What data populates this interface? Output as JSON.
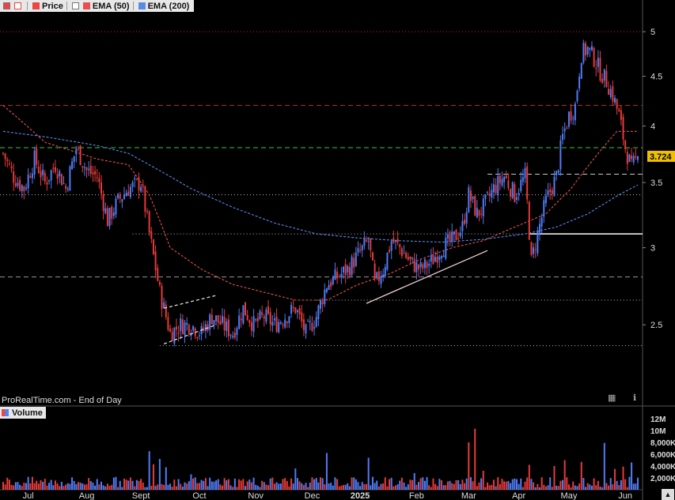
{
  "legend": {
    "price_label": "Price",
    "ema50_label": "EMA (50)",
    "ema200_label": "EMA (200)"
  },
  "source_text": "ProRealTime.com - End of Day",
  "volume_label": "Volume",
  "last_price": "3.724",
  "colors": {
    "up": "#4f7df7",
    "down": "#e83a3a",
    "ema50": "#e85050",
    "ema200": "#5a8ae6",
    "background": "#000000",
    "last_price_badge": "#f0c000"
  },
  "chart_data": [
    {
      "type": "candlestick",
      "title": "",
      "x_tick_labels": [
        "Jul",
        "Aug",
        "Sept",
        "Oct",
        "Nov",
        "Dec",
        "2025",
        "Feb",
        "Mar",
        "Apr",
        "May",
        "Jun"
      ],
      "y_tick_labels": [
        "2.5",
        "3",
        "3.5",
        "4",
        "4.5",
        "5"
      ],
      "ylim": [
        2.15,
        5.25
      ],
      "scale": "log",
      "anchors_close": [
        [
          0,
          3.75
        ],
        [
          5,
          3.55
        ],
        [
          10,
          3.45
        ],
        [
          15,
          3.7
        ],
        [
          20,
          3.5
        ],
        [
          25,
          3.65
        ],
        [
          30,
          3.45
        ],
        [
          35,
          3.8
        ],
        [
          40,
          3.6
        ],
        [
          45,
          3.55
        ],
        [
          50,
          3.2
        ],
        [
          55,
          3.35
        ],
        [
          60,
          3.45
        ],
        [
          66,
          3.5
        ],
        [
          70,
          3.1
        ],
        [
          75,
          2.7
        ],
        [
          80,
          2.45
        ],
        [
          85,
          2.5
        ],
        [
          90,
          2.5
        ],
        [
          95,
          2.45
        ],
        [
          100,
          2.55
        ],
        [
          105,
          2.5
        ],
        [
          110,
          2.45
        ],
        [
          115,
          2.6
        ],
        [
          120,
          2.5
        ],
        [
          125,
          2.55
        ],
        [
          130,
          2.5
        ],
        [
          135,
          2.55
        ],
        [
          140,
          2.6
        ],
        [
          145,
          2.45
        ],
        [
          150,
          2.55
        ],
        [
          155,
          2.75
        ],
        [
          160,
          2.8
        ],
        [
          165,
          2.85
        ],
        [
          170,
          2.95
        ],
        [
          175,
          3.05
        ],
        [
          178,
          2.75
        ],
        [
          182,
          2.85
        ],
        [
          186,
          3.05
        ],
        [
          190,
          3.0
        ],
        [
          195,
          2.9
        ],
        [
          200,
          2.85
        ],
        [
          205,
          2.9
        ],
        [
          210,
          3.0
        ],
        [
          215,
          3.05
        ],
        [
          220,
          3.15
        ],
        [
          223,
          3.4
        ],
        [
          227,
          3.25
        ],
        [
          230,
          3.3
        ],
        [
          235,
          3.45
        ],
        [
          240,
          3.55
        ],
        [
          245,
          3.4
        ],
        [
          250,
          3.55
        ],
        [
          253,
          2.9
        ],
        [
          256,
          3.1
        ],
        [
          260,
          3.35
        ],
        [
          265,
          3.55
        ],
        [
          268,
          3.9
        ],
        [
          271,
          4.1
        ],
        [
          274,
          4.2
        ],
        [
          277,
          4.75
        ],
        [
          280,
          4.8
        ],
        [
          283,
          4.7
        ],
        [
          286,
          4.55
        ],
        [
          289,
          4.45
        ],
        [
          292,
          4.3
        ],
        [
          295,
          4.1
        ],
        [
          298,
          3.8
        ],
        [
          301,
          3.62
        ],
        [
          304,
          3.724
        ]
      ],
      "ema50": [
        [
          0,
          4.2
        ],
        [
          20,
          3.85
        ],
        [
          45,
          3.7
        ],
        [
          60,
          3.65
        ],
        [
          70,
          3.4
        ],
        [
          80,
          3.0
        ],
        [
          95,
          2.85
        ],
        [
          110,
          2.75
        ],
        [
          125,
          2.7
        ],
        [
          140,
          2.65
        ],
        [
          155,
          2.65
        ],
        [
          170,
          2.75
        ],
        [
          185,
          2.82
        ],
        [
          200,
          2.92
        ],
        [
          215,
          3.0
        ],
        [
          230,
          3.05
        ],
        [
          245,
          3.15
        ],
        [
          260,
          3.25
        ],
        [
          272,
          3.45
        ],
        [
          285,
          3.75
        ],
        [
          294,
          3.95
        ],
        [
          304,
          3.95
        ]
      ],
      "ema200": [
        [
          0,
          3.95
        ],
        [
          20,
          3.9
        ],
        [
          45,
          3.82
        ],
        [
          60,
          3.75
        ],
        [
          75,
          3.6
        ],
        [
          90,
          3.45
        ],
        [
          110,
          3.3
        ],
        [
          130,
          3.18
        ],
        [
          150,
          3.1
        ],
        [
          170,
          3.07
        ],
        [
          190,
          3.05
        ],
        [
          210,
          3.04
        ],
        [
          230,
          3.06
        ],
        [
          250,
          3.1
        ],
        [
          265,
          3.15
        ],
        [
          280,
          3.25
        ],
        [
          295,
          3.4
        ],
        [
          304,
          3.48
        ]
      ],
      "horizontal_levels": [
        {
          "y": 5.0,
          "color": "#e01515",
          "style": "dotted"
        },
        {
          "y": 4.2,
          "color": "#d31a1a",
          "style": "dashed"
        },
        {
          "y": 3.8,
          "color": "#2ecc40",
          "style": "dashed"
        },
        {
          "y": 3.57,
          "color": "#cccccc",
          "style": "dashed",
          "x_start": 232
        },
        {
          "y": 3.4,
          "color": "#bbbbbb",
          "style": "dotted"
        },
        {
          "y": 3.1,
          "color": "#ffffff",
          "style": "solid",
          "x_start": 252
        },
        {
          "y": 3.1,
          "color": "#bbbbbb",
          "style": "dotted",
          "x_end": 252,
          "x_from": 62
        },
        {
          "y": 2.8,
          "color": "#999999",
          "style": "dashed"
        },
        {
          "y": 2.65,
          "color": "#bbbbbb",
          "style": "dotted",
          "x_from": 150
        },
        {
          "y": 2.38,
          "color": "#bbbbbb",
          "style": "dotted",
          "x_from": 75
        }
      ],
      "trendlines": [
        {
          "from": [
            174,
            2.63
          ],
          "to": [
            232,
            2.98
          ],
          "color": "#f0d0d0",
          "style": "solid"
        },
        {
          "from": [
            77,
            2.39
          ],
          "to": [
            102,
            2.5
          ],
          "color": "#dddddd",
          "style": "dashed"
        },
        {
          "from": [
            77,
            2.6
          ],
          "to": [
            102,
            2.68
          ],
          "color": "#dddddd",
          "style": "dashed"
        }
      ]
    },
    {
      "type": "bar",
      "title": "",
      "series_name": "Volume",
      "y_tick_labels": [
        "12M",
        "10M",
        "8,000K",
        "6,000K",
        "4,000K",
        "2,000K"
      ],
      "ylim": [
        0,
        12000000
      ],
      "spikes": [
        [
          70,
          6500000
        ],
        [
          72,
          4300000
        ],
        [
          75,
          5200000
        ],
        [
          78,
          3800000
        ],
        [
          90,
          2600000
        ],
        [
          140,
          3600000
        ],
        [
          155,
          6200000
        ],
        [
          175,
          5400000
        ],
        [
          197,
          2800000
        ],
        [
          223,
          8000000
        ],
        [
          226,
          10300000
        ],
        [
          230,
          3200000
        ],
        [
          252,
          4200000
        ],
        [
          264,
          4000000
        ],
        [
          269,
          5000000
        ],
        [
          277,
          4700000
        ],
        [
          288,
          7900000
        ],
        [
          293,
          3500000
        ],
        [
          297,
          3900000
        ],
        [
          301,
          4600000
        ]
      ]
    }
  ]
}
